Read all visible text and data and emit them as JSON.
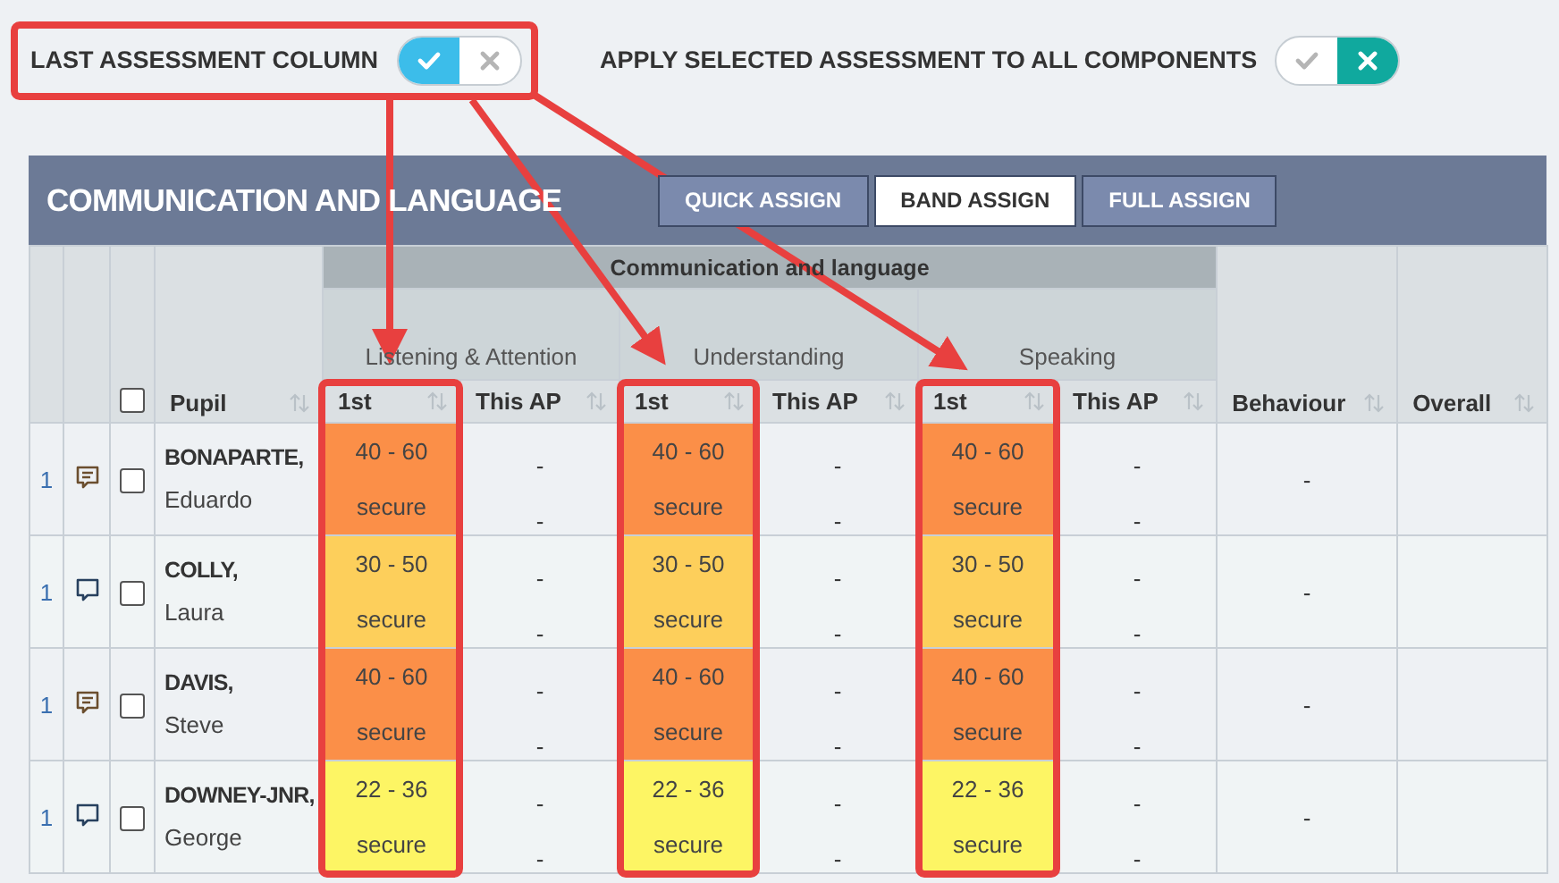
{
  "toggles": [
    {
      "label": "LAST ASSESSMENT COLUMN",
      "on": true
    },
    {
      "label": "APPLY SELECTED ASSESSMENT TO ALL COMPONENTS",
      "on": false
    }
  ],
  "panel": {
    "title": "COMMUNICATION AND LANGUAGE",
    "buttons": [
      {
        "label": "QUICK ASSIGN",
        "selected": false
      },
      {
        "label": "BAND ASSIGN",
        "selected": true
      },
      {
        "label": "FULL ASSIGN",
        "selected": false
      }
    ]
  },
  "table": {
    "group": "Communication and language",
    "select_all": {
      "checked": false
    },
    "pupil_header": "Pupil",
    "behaviour_header": "Behaviour",
    "overall_header": "Overall",
    "components": [
      {
        "name": "Listening & Attention",
        "columns": [
          "1st",
          "This AP"
        ]
      },
      {
        "name": "Understanding",
        "columns": [
          "1st",
          "This AP"
        ]
      },
      {
        "name": "Speaking",
        "columns": [
          "1st",
          "This AP"
        ]
      }
    ],
    "rows": [
      {
        "number": "1",
        "has_comment": true,
        "checked": false,
        "surname": "BONAPARTE,",
        "forename": "Eduardo",
        "assessments": [
          {
            "band": "40 - 60",
            "step": "secure",
            "color": "#fb8f48",
            "this_ap": [
              "-",
              "-"
            ]
          },
          {
            "band": "40 - 60",
            "step": "secure",
            "color": "#fb8f48",
            "this_ap": [
              "-",
              "-"
            ]
          },
          {
            "band": "40 - 60",
            "step": "secure",
            "color": "#fb8f48",
            "this_ap": [
              "-",
              "-"
            ]
          }
        ],
        "behaviour": "-"
      },
      {
        "number": "1",
        "has_comment": false,
        "checked": false,
        "surname": "COLLY,",
        "forename": "Laura",
        "assessments": [
          {
            "band": "30 - 50",
            "step": "secure",
            "color": "#fdcf5b",
            "this_ap": [
              "-",
              "-"
            ]
          },
          {
            "band": "30 - 50",
            "step": "secure",
            "color": "#fdcf5b",
            "this_ap": [
              "-",
              "-"
            ]
          },
          {
            "band": "30 - 50",
            "step": "secure",
            "color": "#fdcf5b",
            "this_ap": [
              "-",
              "-"
            ]
          }
        ],
        "behaviour": "-"
      },
      {
        "number": "1",
        "has_comment": true,
        "checked": false,
        "surname": "DAVIS,",
        "forename": "Steve",
        "assessments": [
          {
            "band": "40 - 60",
            "step": "secure",
            "color": "#fb8f48",
            "this_ap": [
              "-",
              "-"
            ]
          },
          {
            "band": "40 - 60",
            "step": "secure",
            "color": "#fb8f48",
            "this_ap": [
              "-",
              "-"
            ]
          },
          {
            "band": "40 - 60",
            "step": "secure",
            "color": "#fb8f48",
            "this_ap": [
              "-",
              "-"
            ]
          }
        ],
        "behaviour": "-"
      },
      {
        "number": "1",
        "has_comment": false,
        "checked": false,
        "surname": "DOWNEY-JNR,",
        "forename": "George",
        "assessments": [
          {
            "band": "22 - 36",
            "step": "secure",
            "color": "#fdf564",
            "this_ap": [
              "-",
              "-"
            ]
          },
          {
            "band": "22 - 36",
            "step": "secure",
            "color": "#fdf564",
            "this_ap": [
              "-",
              "-"
            ]
          },
          {
            "band": "22 - 36",
            "step": "secure",
            "color": "#fdf564",
            "this_ap": [
              "-",
              "-"
            ]
          }
        ],
        "behaviour": "-"
      }
    ]
  }
}
